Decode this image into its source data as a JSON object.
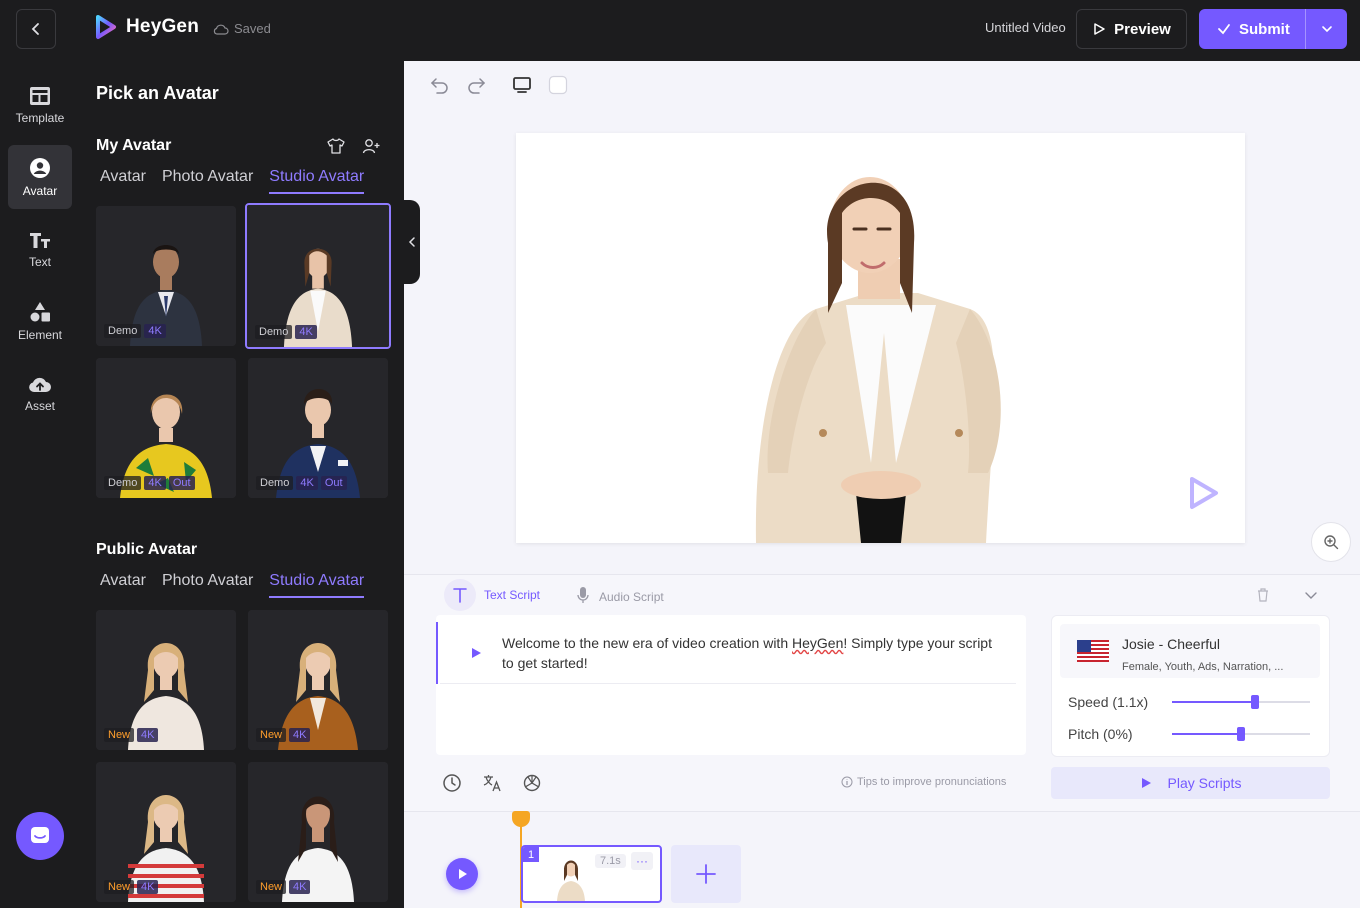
{
  "header": {
    "brand": "HeyGen",
    "saved_status": "Saved",
    "video_title": "Untitled Video",
    "preview_label": "Preview",
    "submit_label": "Submit"
  },
  "rail": {
    "items": [
      {
        "label": "Template",
        "icon": "template-icon"
      },
      {
        "label": "Avatar",
        "icon": "avatar-icon"
      },
      {
        "label": "Text",
        "icon": "text-icon"
      },
      {
        "label": "Element",
        "icon": "element-icon"
      },
      {
        "label": "Asset",
        "icon": "asset-icon"
      }
    ],
    "active": "Avatar"
  },
  "panel": {
    "title": "Pick an Avatar",
    "my_avatar": {
      "title": "My Avatar",
      "tabs": [
        "Avatar",
        "Photo Avatar",
        "Studio Avatar"
      ],
      "active_tab": "Studio Avatar",
      "cards": [
        {
          "badges": [
            "Demo",
            "4K"
          ]
        },
        {
          "badges": [
            "Demo",
            "4K"
          ],
          "selected": true
        },
        {
          "badges": [
            "Demo",
            "4K",
            "Out"
          ]
        },
        {
          "badges": [
            "Demo",
            "4K",
            "Out"
          ]
        }
      ]
    },
    "public_avatar": {
      "title": "Public Avatar",
      "tabs": [
        "Avatar",
        "Photo Avatar",
        "Studio Avatar"
      ],
      "active_tab": "Studio Avatar",
      "cards": [
        {
          "badges": [
            "New",
            "4K"
          ]
        },
        {
          "badges": [
            "New",
            "4K"
          ]
        },
        {
          "badges": [
            "New",
            "4K"
          ]
        },
        {
          "badges": [
            "New",
            "4K"
          ]
        }
      ]
    }
  },
  "script": {
    "tabs": {
      "text": "Text Script",
      "audio": "Audio Script"
    },
    "text_before": "Welcome to the new era of video creation with ",
    "text_flagged": "HeyGen",
    "text_after": "! Simply type your script to get started!",
    "tips": "Tips to improve pronunciations",
    "play_scripts": "Play Scripts"
  },
  "voice": {
    "name": "Josie - Cheerful",
    "tags": "Female, Youth, Ads, Narration, ...",
    "speed_label": "Speed (1.1x)",
    "speed_fraction": 0.6,
    "pitch_label": "Pitch (0%)",
    "pitch_fraction": 0.5
  },
  "timeline": {
    "scene_number": "1",
    "scene_duration": "7.1s"
  },
  "colors": {
    "accent": "#7559ff",
    "dark": "#1c1c1e",
    "playhead": "#f5a623"
  }
}
